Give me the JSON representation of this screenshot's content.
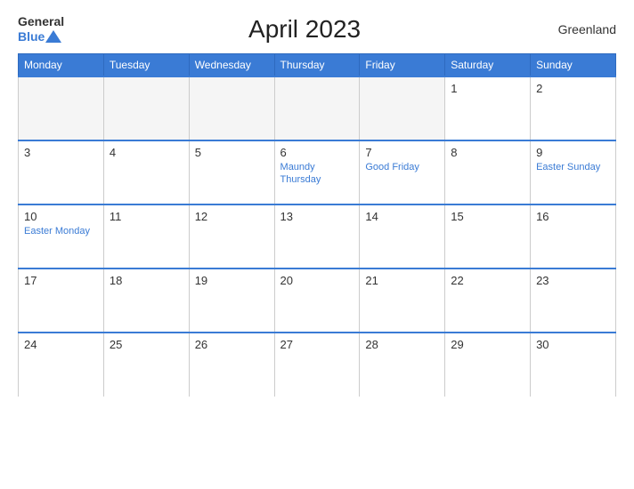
{
  "header": {
    "title": "April 2023",
    "region": "Greenland",
    "logo_general": "General",
    "logo_blue": "Blue"
  },
  "columns": [
    "Monday",
    "Tuesday",
    "Wednesday",
    "Thursday",
    "Friday",
    "Saturday",
    "Sunday"
  ],
  "weeks": [
    [
      {
        "day": "",
        "event": ""
      },
      {
        "day": "",
        "event": ""
      },
      {
        "day": "",
        "event": ""
      },
      {
        "day": "",
        "event": ""
      },
      {
        "day": "",
        "event": ""
      },
      {
        "day": "1",
        "event": ""
      },
      {
        "day": "2",
        "event": ""
      }
    ],
    [
      {
        "day": "3",
        "event": ""
      },
      {
        "day": "4",
        "event": ""
      },
      {
        "day": "5",
        "event": ""
      },
      {
        "day": "6",
        "event": "Maundy Thursday"
      },
      {
        "day": "7",
        "event": "Good Friday"
      },
      {
        "day": "8",
        "event": ""
      },
      {
        "day": "9",
        "event": "Easter Sunday"
      }
    ],
    [
      {
        "day": "10",
        "event": "Easter Monday"
      },
      {
        "day": "11",
        "event": ""
      },
      {
        "day": "12",
        "event": ""
      },
      {
        "day": "13",
        "event": ""
      },
      {
        "day": "14",
        "event": ""
      },
      {
        "day": "15",
        "event": ""
      },
      {
        "day": "16",
        "event": ""
      }
    ],
    [
      {
        "day": "17",
        "event": ""
      },
      {
        "day": "18",
        "event": ""
      },
      {
        "day": "19",
        "event": ""
      },
      {
        "day": "20",
        "event": ""
      },
      {
        "day": "21",
        "event": ""
      },
      {
        "day": "22",
        "event": ""
      },
      {
        "day": "23",
        "event": ""
      }
    ],
    [
      {
        "day": "24",
        "event": ""
      },
      {
        "day": "25",
        "event": ""
      },
      {
        "day": "26",
        "event": ""
      },
      {
        "day": "27",
        "event": ""
      },
      {
        "day": "28",
        "event": ""
      },
      {
        "day": "29",
        "event": ""
      },
      {
        "day": "30",
        "event": ""
      }
    ]
  ]
}
